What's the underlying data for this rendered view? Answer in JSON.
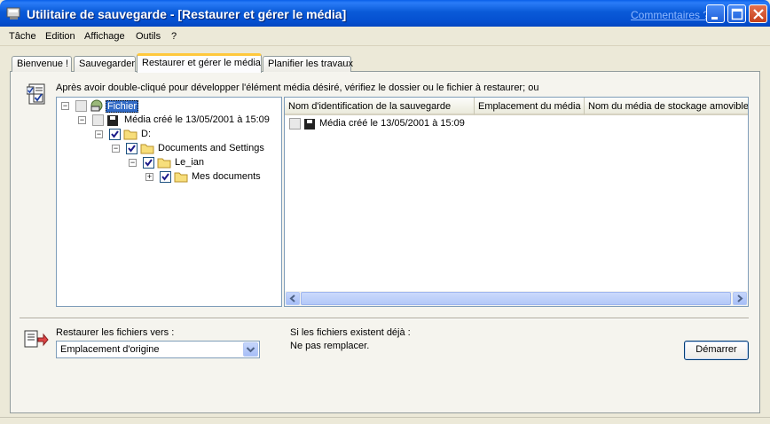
{
  "window": {
    "title": "Utilitaire de sauvegarde - [Restaurer et gérer le média]",
    "comments_link": "Commentaires ?"
  },
  "menu": [
    "Tâche",
    "Edition",
    "Affichage",
    "Outils",
    "?"
  ],
  "tabs": [
    {
      "label": "Bienvenue !",
      "active": false
    },
    {
      "label": "Sauvegarder",
      "active": false
    },
    {
      "label": "Restaurer et gérer le média",
      "active": true
    },
    {
      "label": "Planifier les travaux",
      "active": false
    }
  ],
  "instructions": "Après avoir double-cliqué pour développer l'élément média désiré, vérifiez le dossier ou le fichier à restaurer; ou",
  "tree": [
    {
      "label": "Fichier",
      "expander": "−",
      "checked": false,
      "icon": "file-media-icon",
      "selected": true
    },
    {
      "label": "Média créé le 13/05/2001 à 15:09",
      "expander": "−",
      "checked": false,
      "icon": "tape-media-icon"
    },
    {
      "label": "D:",
      "expander": "−",
      "checked": true,
      "icon": "folder-icon"
    },
    {
      "label": "Documents and Settings",
      "expander": "−",
      "checked": true,
      "icon": "folder-icon"
    },
    {
      "label": "Le_ian",
      "expander": "−",
      "checked": true,
      "icon": "folder-icon"
    },
    {
      "label": "Mes documents",
      "expander": "+",
      "checked": true,
      "icon": "folder-icon"
    }
  ],
  "list": {
    "columns": [
      "Nom d'identification de la sauvegarde",
      "Emplacement du média",
      "Nom du média de stockage amovible"
    ],
    "rows": [
      {
        "name": "Média créé le 13/05/2001 à 15:09",
        "checked": false
      }
    ]
  },
  "restore": {
    "label": "Restaurer les fichiers vers :",
    "selected": "Emplacement d'origine"
  },
  "exists": {
    "label": "Si les fichiers existent déjà :",
    "value": "Ne pas remplacer."
  },
  "start_button": "Démarrer"
}
